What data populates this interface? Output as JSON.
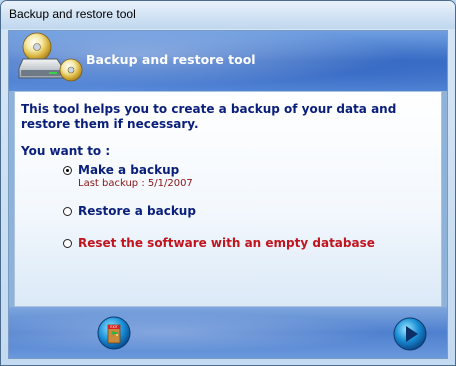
{
  "window": {
    "title": "Backup and restore tool"
  },
  "banner": {
    "title": "Backup and restore tool",
    "icon": "backup-disc-icon"
  },
  "content": {
    "intro": "This tool helps you to create a backup of your data and restore them if necessary.",
    "prompt": "You want to :",
    "options": [
      {
        "label": "Make a backup",
        "selected": true
      },
      {
        "label": "Restore a backup",
        "selected": false
      },
      {
        "label": "Reset the software with an empty database",
        "selected": false
      }
    ],
    "last_backup": "Last backup : 5/1/2007"
  },
  "footer": {
    "exit_icon": "exit-door-icon",
    "exit_sign": "EXIT",
    "next_icon": "next-arrow-icon"
  },
  "colors": {
    "text_primary": "#0a1f7a",
    "text_danger": "#c0141e",
    "banner_blue": "#3f73c9"
  }
}
